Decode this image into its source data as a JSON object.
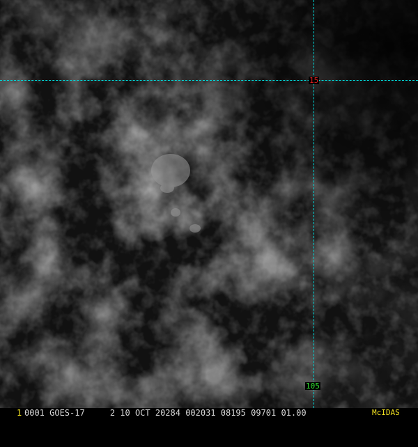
{
  "image": {
    "description_colors": {
      "background": "#000000",
      "cloud": "#7a7a7a",
      "grid": "#00d8d8"
    }
  },
  "grid": {
    "latitude_label": "15",
    "longitude_label": "105",
    "latitude_label_color": "#e02020",
    "longitude_label_color": "#30e030"
  },
  "status_bar": {
    "frame_number": "1",
    "text": "0001 GOES-17     2 10 OCT 20284 002031 08195 09701 01.00",
    "brand": "McIDAS"
  }
}
